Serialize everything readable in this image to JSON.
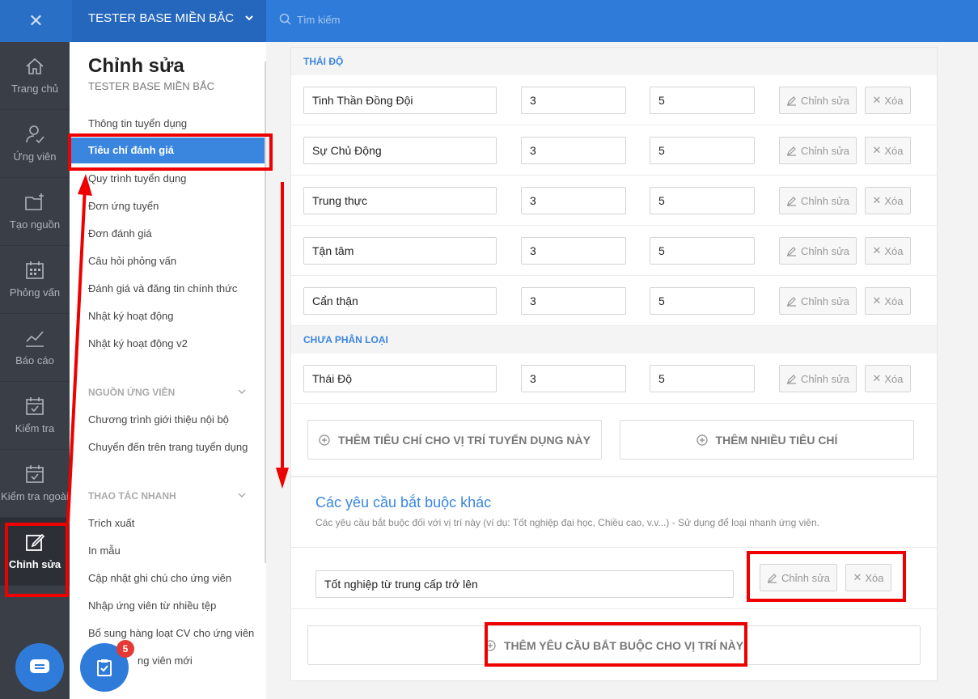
{
  "topbar": {
    "company": "TESTER BASE MIỀN BẮC",
    "search_placeholder": "Tìm kiếm"
  },
  "rail": {
    "items": [
      {
        "label": "Trang chủ",
        "icon": "home-icon"
      },
      {
        "label": "Ứng viên",
        "icon": "user-check-icon"
      },
      {
        "label": "Tạo nguồn",
        "icon": "folder-plus-icon"
      },
      {
        "label": "Phỏng vấn",
        "icon": "calendar-icon"
      },
      {
        "label": "Báo cáo",
        "icon": "chart-line-icon"
      },
      {
        "label": "Kiểm tra",
        "icon": "calendar-check-icon"
      },
      {
        "label": "Kiểm tra ngoài",
        "icon": "calendar-check-icon"
      },
      {
        "label": "Chỉnh sửa",
        "icon": "edit-icon"
      }
    ]
  },
  "sidebar": {
    "title": "Chỉnh sửa",
    "subtitle": "TESTER BASE MIỀN BẮC",
    "links": [
      "Thông tin tuyển dụng",
      "Tiêu chí đánh giá",
      "Quy trình tuyển dụng",
      "Đơn ứng tuyển",
      "Đơn đánh giá",
      "Câu hỏi phỏng vấn",
      "Đánh giá và đăng tin chính thức",
      "Nhật ký hoạt động",
      "Nhật ký hoạt động v2"
    ],
    "section_sources": "NGUỒN ỨNG VIÊN",
    "source_links": [
      "Chương trình giới thiệu nội bộ",
      "Chuyển đến trên trang tuyển dụng"
    ],
    "section_quick": "THAO TÁC NHANH",
    "quick_links": [
      "Trích xuất",
      "In mẫu",
      "Cập nhật ghi chú cho ứng viên",
      "Nhập ứng viên từ nhiều tệp",
      "Bổ sung hàng loạt CV cho ứng viên",
      "ng viên mới"
    ],
    "badge_count": "5"
  },
  "main": {
    "group1": "THÁI ĐỘ",
    "criteria": [
      {
        "name": "Tinh Thần Đồng Đội",
        "weight": "3",
        "max": "5"
      },
      {
        "name": "Sự Chủ Động",
        "weight": "3",
        "max": "5"
      },
      {
        "name": "Trung thực",
        "weight": "3",
        "max": "5"
      },
      {
        "name": "Tận tâm",
        "weight": "3",
        "max": "5"
      },
      {
        "name": "Cẩn thận",
        "weight": "3",
        "max": "5"
      }
    ],
    "group2": "CHƯA PHÂN LOẠI",
    "uncategorized": [
      {
        "name": "Thái Độ",
        "weight": "3",
        "max": "5"
      }
    ],
    "edit_label": "Chỉnh sửa",
    "delete_label": "Xóa",
    "add_criterion": "THÊM TIÊU CHÍ CHO VỊ TRÍ TUYỂN DỤNG NÀY",
    "add_many": "THÊM NHIỀU TIÊU CHÍ",
    "req_title": "Các yêu cầu bắt buộc khác",
    "req_desc": "Các yêu cầu bắt buộc đối với vị trí này (ví dụ: Tốt nghiệp đại học, Chiều cao, v.v...) - Sử dụng để loại nhanh ứng viên.",
    "requirement": "Tốt nghiệp từ trung cấp trở lên",
    "add_requirement": "THÊM YÊU CẦU BẮT BUỘC CHO VỊ TRÍ NÀY"
  },
  "colors": {
    "brand": "#2f7bd9",
    "annotation": "#ee0000"
  }
}
